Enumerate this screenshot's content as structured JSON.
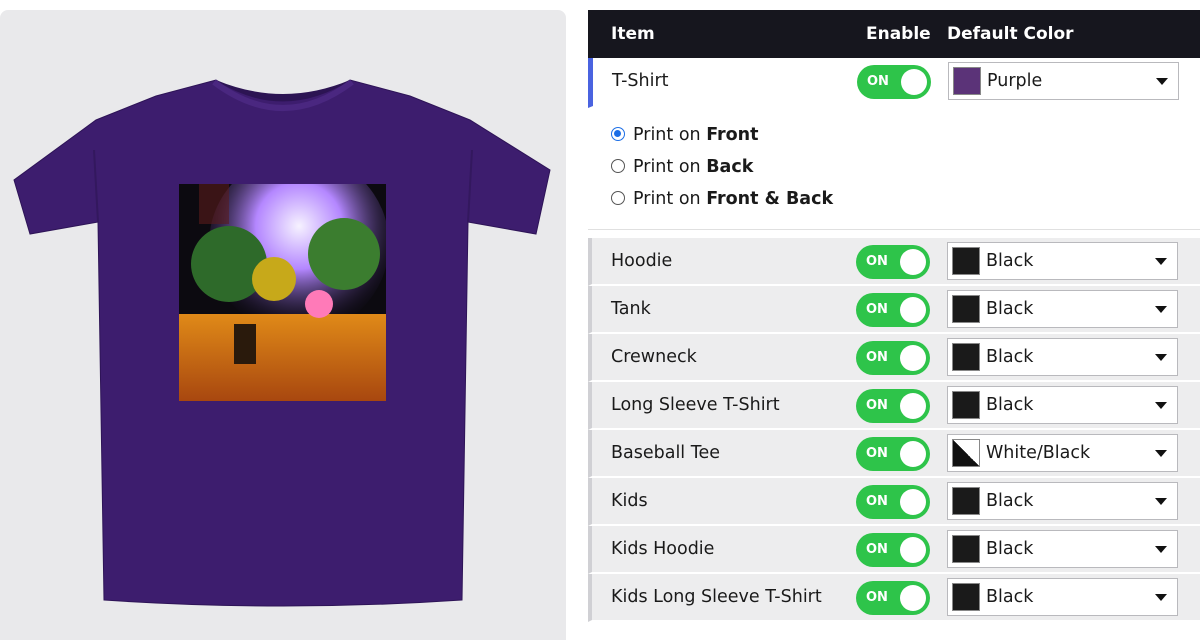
{
  "colors": {
    "header_bg": "#16161e",
    "toggle_on": "#2ec44a",
    "active_accent": "#4a63e0",
    "shirt_purple": "#3d1d6e",
    "swatch_purple": "#5b3378",
    "swatch_black": "#1a1a1a"
  },
  "table": {
    "headers": {
      "item": "Item",
      "enable": "Enable",
      "color": "Default Color"
    },
    "active_item": {
      "label": "T-Shirt",
      "toggle": "ON",
      "color": "Purple",
      "swatch": "#5b3378"
    },
    "print_options": [
      {
        "prefix": "Print on ",
        "bold": "Front",
        "checked": true
      },
      {
        "prefix": "Print on ",
        "bold": "Back",
        "checked": false
      },
      {
        "prefix": "Print on ",
        "bold": "Front & Back",
        "checked": false
      }
    ],
    "rows": [
      {
        "label": "Hoodie",
        "toggle": "ON",
        "color": "Black",
        "swatch": "black"
      },
      {
        "label": "Tank",
        "toggle": "ON",
        "color": "Black",
        "swatch": "black"
      },
      {
        "label": "Crewneck",
        "toggle": "ON",
        "color": "Black",
        "swatch": "black"
      },
      {
        "label": "Long Sleeve T-Shirt",
        "toggle": "ON",
        "color": "Black",
        "swatch": "black"
      },
      {
        "label": "Baseball Tee",
        "toggle": "ON",
        "color": "White/Black",
        "swatch": "white-black"
      },
      {
        "label": "Kids",
        "toggle": "ON",
        "color": "Black",
        "swatch": "black"
      },
      {
        "label": "Kids Hoodie",
        "toggle": "ON",
        "color": "Black",
        "swatch": "black"
      },
      {
        "label": "Kids Long Sleeve T-Shirt",
        "toggle": "ON",
        "color": "Black",
        "swatch": "black"
      }
    ]
  },
  "icons": {
    "caret": "caret-down-icon",
    "toggle_knob": "toggle-knob-icon"
  }
}
